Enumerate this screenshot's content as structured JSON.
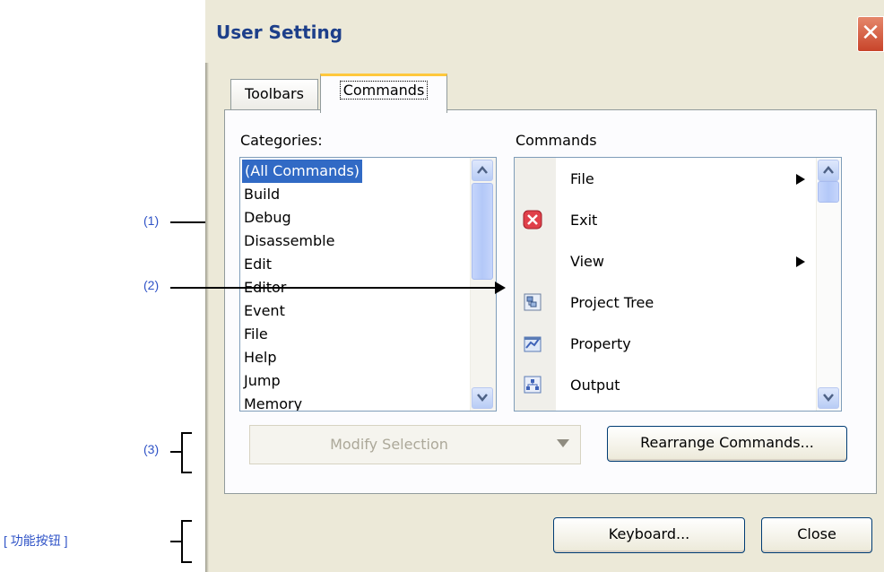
{
  "dialog": {
    "title": "User Setting",
    "close_glyph": "✕",
    "tabs": [
      {
        "label": "Toolbars"
      },
      {
        "label": "Commands"
      }
    ],
    "categories_label": "Categories:",
    "commands_label": "Commands",
    "categories": [
      "(All Commands)",
      "Build",
      "Debug",
      "Disassemble",
      "Edit",
      "Editor",
      "Event",
      "File",
      "Help",
      "Jump",
      "Memory"
    ],
    "commands": [
      {
        "label": "File",
        "icon": "blank",
        "submenu": true
      },
      {
        "label": "Exit",
        "icon": "exit-icon",
        "submenu": false
      },
      {
        "label": "View",
        "icon": "blank",
        "submenu": true
      },
      {
        "label": "Project Tree",
        "icon": "project-tree-icon",
        "submenu": false
      },
      {
        "label": "Property",
        "icon": "property-icon",
        "submenu": false
      },
      {
        "label": "Output",
        "icon": "output-icon",
        "submenu": false
      }
    ],
    "modify_selection": "Modify Selection",
    "rearrange_button": "Rearrange Commands...",
    "keyboard_button": "Keyboard...",
    "close_button": "Close"
  },
  "annotations": {
    "a1": "(1)",
    "a2": "(2)",
    "a3": "(3)",
    "function_buttons": "[ 功能按钮 ]"
  },
  "colors": {
    "accent_selection": "#316ac5",
    "title_text": "#1d3f8a",
    "annotation": "#2f53c7",
    "tab_highlight": "#ffc83c"
  }
}
